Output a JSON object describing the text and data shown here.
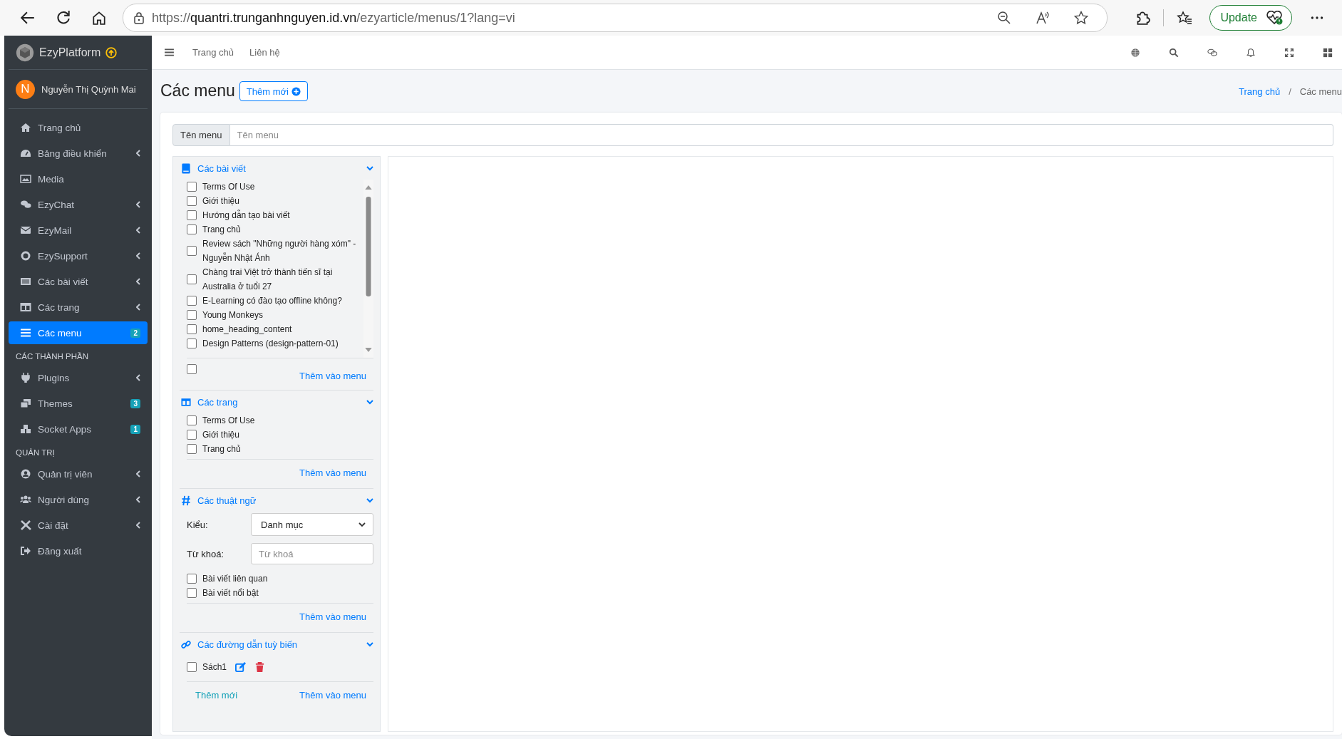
{
  "browser": {
    "url_scheme": "https://",
    "url_host": "quantri.trunganhnguyen.id.vn",
    "url_path": "/ezyarticle/menus/1?lang=vi",
    "update_button": "Update"
  },
  "sidebar": {
    "brand": "EzyPlatform",
    "user": {
      "initial": "N",
      "name": "Nguyễn Thị Quỳnh Mai"
    },
    "groups": [
      {
        "items": [
          {
            "label": "Trang chủ",
            "has_submenu": false,
            "selected": false
          },
          {
            "label": "Bảng điều khiển",
            "has_submenu": true,
            "selected": false
          },
          {
            "label": "Media",
            "has_submenu": false,
            "selected": false
          },
          {
            "label": "EzyChat",
            "has_submenu": true,
            "selected": false
          },
          {
            "label": "EzyMail",
            "has_submenu": true,
            "selected": false
          },
          {
            "label": "EzySupport",
            "has_submenu": true,
            "selected": false
          },
          {
            "label": "Các bài viết",
            "has_submenu": true,
            "selected": false
          },
          {
            "label": "Các trang",
            "has_submenu": true,
            "selected": false
          },
          {
            "label": "Các menu",
            "has_submenu": false,
            "selected": true,
            "badge": "2"
          }
        ]
      },
      {
        "heading": "CÁC THÀNH PHẦN",
        "items": [
          {
            "label": "Plugins",
            "has_submenu": true,
            "selected": false
          },
          {
            "label": "Themes",
            "has_submenu": false,
            "selected": false,
            "badge": "3"
          },
          {
            "label": "Socket Apps",
            "has_submenu": false,
            "selected": false,
            "badge": "1"
          }
        ]
      },
      {
        "heading": "QUẢN TRỊ",
        "items": [
          {
            "label": "Quản trị viên",
            "has_submenu": true,
            "selected": false
          },
          {
            "label": "Người dùng",
            "has_submenu": true,
            "selected": false
          },
          {
            "label": "Cài đặt",
            "has_submenu": true,
            "selected": false
          },
          {
            "label": "Đăng xuất",
            "has_submenu": false,
            "selected": false
          }
        ]
      }
    ]
  },
  "top_nav": {
    "links": [
      "Trang chủ",
      "Liên hệ"
    ]
  },
  "page": {
    "title": "Các menu",
    "add_button": "Thêm mới",
    "breadcrumb_separator": "/",
    "breadcrumb": [
      {
        "kind": "link",
        "label": "Trang chủ"
      },
      {
        "kind": "current",
        "label": "Các menu"
      }
    ]
  },
  "name_field": {
    "label": "Tên menu",
    "placeholder": "Tên menu"
  },
  "panels": [
    {
      "kind": "posts",
      "title": "Các bài viết",
      "expanded": true,
      "items": [
        {
          "label": "Terms Of Use",
          "checked": false
        },
        {
          "label": "Giới thiệu",
          "checked": false
        },
        {
          "label": "Hướng dẫn tạo bài viết",
          "checked": false
        },
        {
          "label": "Trang chủ",
          "checked": false
        },
        {
          "label": "Review sách \"Những người hàng xóm\" - Nguyễn Nhật Ánh",
          "checked": false
        },
        {
          "label": "Chàng trai Việt trở thành tiến sĩ tại Australia ở tuổi 27",
          "checked": false
        },
        {
          "label": "E-Learning có đào tạo offline không?",
          "checked": false
        },
        {
          "label": "Young Monkeys",
          "checked": false
        },
        {
          "label": "home_heading_content",
          "checked": false
        },
        {
          "label": "Design Patterns (design-pattern-01)",
          "checked": false
        }
      ],
      "loose_checkbox": {
        "checked": false
      },
      "add_button": "Thêm vào menu"
    },
    {
      "kind": "pages",
      "title": "Các trang",
      "expanded": true,
      "items": [
        {
          "label": "Terms Of Use",
          "checked": false
        },
        {
          "label": "Giới thiệu",
          "checked": false
        },
        {
          "label": "Trang chủ",
          "checked": false
        }
      ],
      "add_button": "Thêm vào menu"
    },
    {
      "kind": "terms",
      "title": "Các thuật ngữ",
      "expanded": true,
      "type_label": "Kiểu:",
      "type_value": "Danh mục",
      "keyword_label": "Từ khoá:",
      "keyword_placeholder": "Từ khoá",
      "items": [
        {
          "label": "Bài viết liên quan",
          "checked": false
        },
        {
          "label": "Bài viết nổi bật",
          "checked": false
        }
      ],
      "add_button": "Thêm vào menu"
    },
    {
      "kind": "links",
      "title": "Các đường dẫn tuỳ biến",
      "expanded": true,
      "items": [
        {
          "label": "Sách1",
          "checked": false
        }
      ],
      "new_button": "Thêm mới",
      "add_button": "Thêm vào menu"
    }
  ]
}
